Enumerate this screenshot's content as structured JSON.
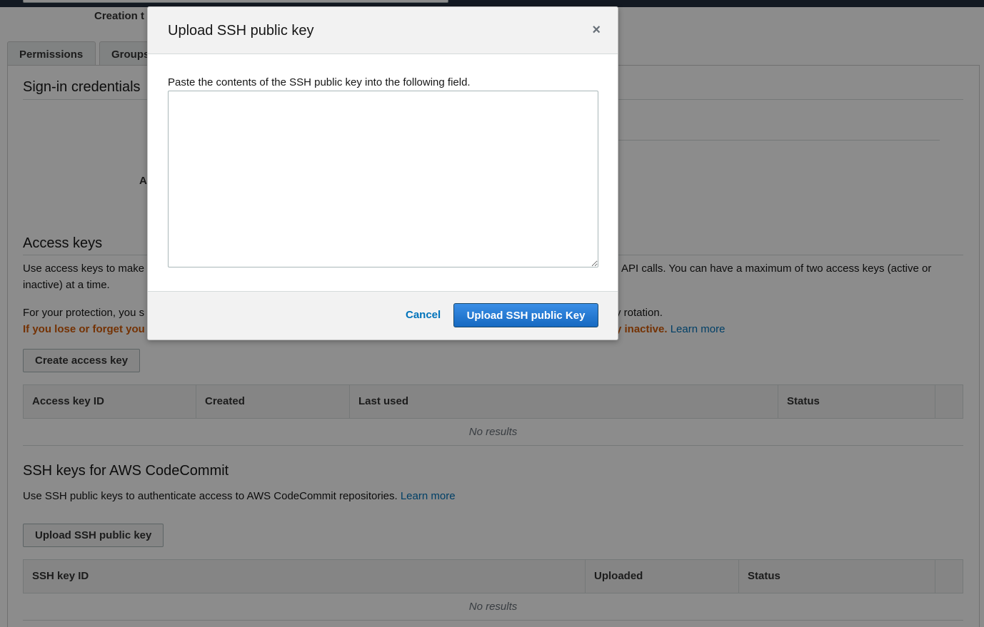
{
  "header": {
    "summary_label": "Creation t"
  },
  "tabs": [
    {
      "label": "Permissions"
    },
    {
      "label": "Groups"
    }
  ],
  "sign_in": {
    "title": "Sign-in credentials",
    "partial_label": "A"
  },
  "access_keys": {
    "title": "Access keys",
    "desc_left": "Use access keys to make",
    "desc_right": "API calls. You can have a maximum of two access keys (active or",
    "desc_line2": "inactive) at a time.",
    "protection_left": "For your protection, you s",
    "protection_right": "y rotation.",
    "warning_left": "If you lose or forget you",
    "warning_right": "y inactive.",
    "learn_more": "Learn more",
    "create_button": "Create access key",
    "columns": [
      "Access key ID",
      "Created",
      "Last used",
      "Status",
      ""
    ],
    "empty": "No results"
  },
  "ssh_keys": {
    "title": "SSH keys for AWS CodeCommit",
    "desc": "Use SSH public keys to authenticate access to AWS CodeCommit repositories.",
    "learn_more": "Learn more",
    "upload_button": "Upload SSH public key",
    "columns": [
      "SSH key ID",
      "Uploaded",
      "Status",
      ""
    ],
    "empty": "No results"
  },
  "modal": {
    "title": "Upload SSH public key",
    "close_icon": "×",
    "instruction": "Paste the contents of the SSH public key into the following field.",
    "textarea_value": "",
    "cancel_label": "Cancel",
    "submit_label": "Upload SSH public Key"
  },
  "colors": {
    "primary": "#1669c1",
    "link": "#0073bb",
    "warning": "#d45b07",
    "topbar": "#232f3e"
  }
}
